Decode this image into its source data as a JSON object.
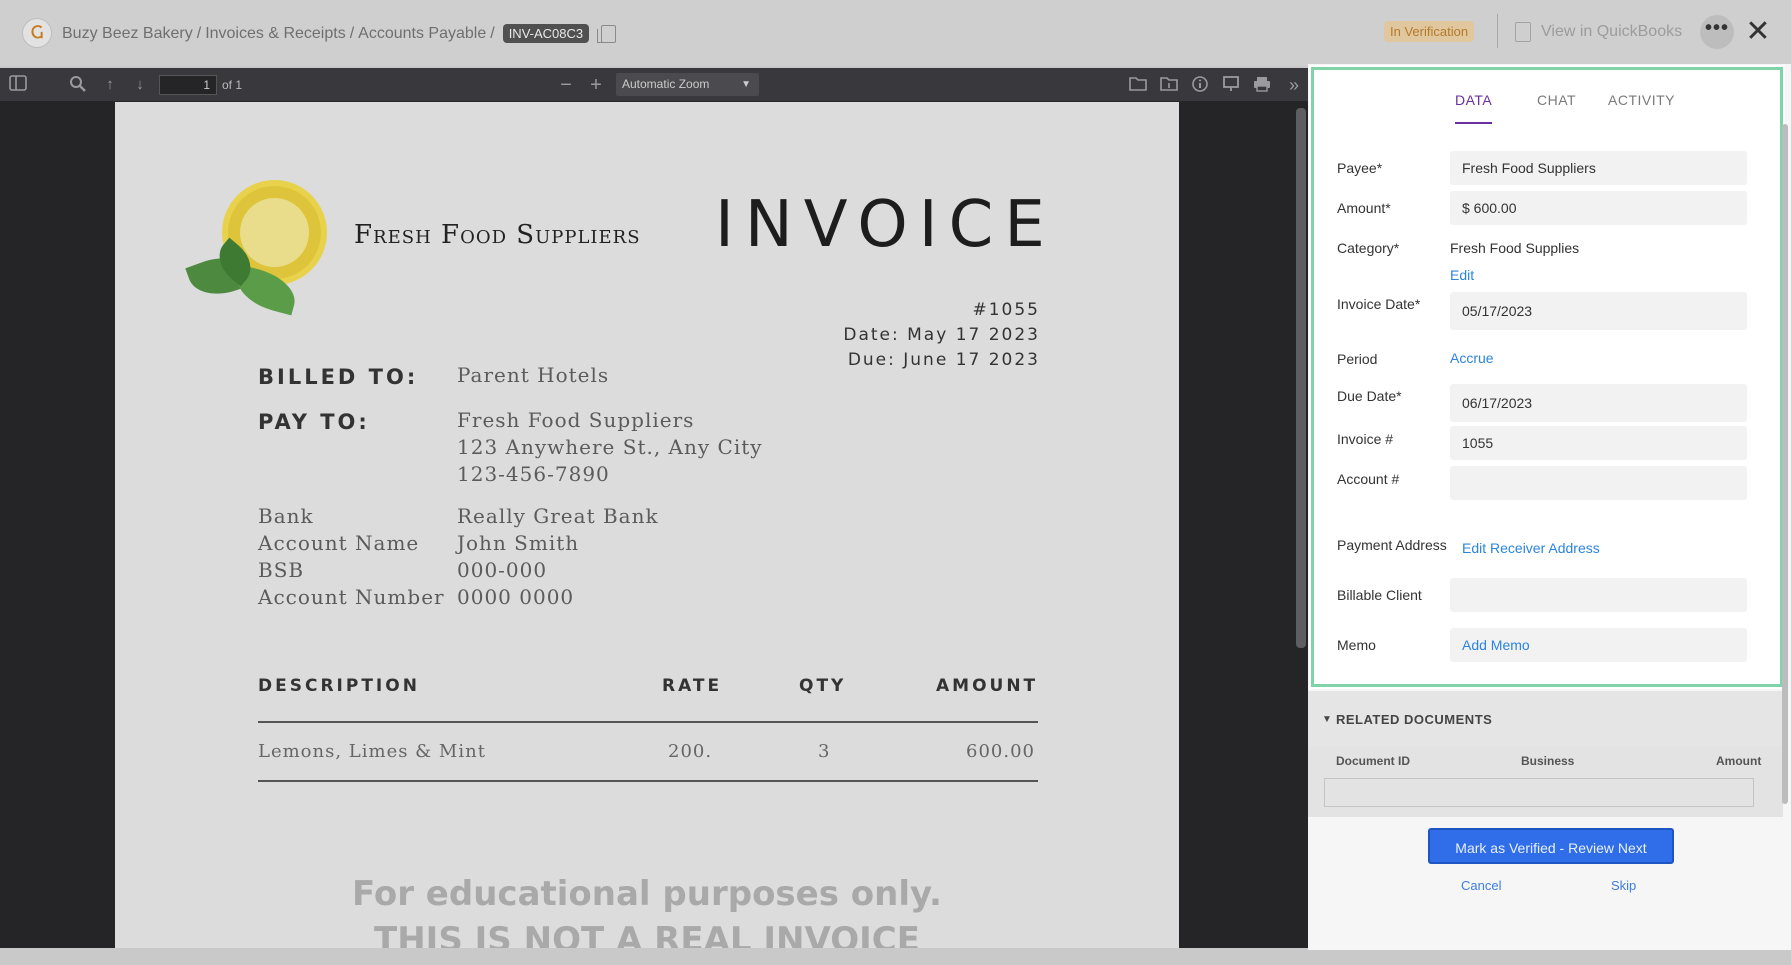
{
  "header": {
    "breadcrumb": [
      "Buzy Beez Bakery",
      "Invoices & Receipts",
      "Accounts Payable"
    ],
    "separator": "/",
    "invoice_id": "INV-AC08C3",
    "status": "In Verification",
    "quickbooks_label": "View in QuickBooks",
    "more_label": "•••",
    "close_label": "✕",
    "logo_glyph": "Ⴚ"
  },
  "pdf_toolbar": {
    "page_number": "1",
    "page_of": "of 1",
    "zoom": "Automatic Zoom",
    "icons": [
      "sidebar-toggle-icon",
      "search-icon",
      "arrow-up-icon",
      "arrow-down-icon",
      "zoom-out-icon",
      "zoom-in-icon",
      "open-file-icon",
      "save-icon",
      "info-icon",
      "present-icon",
      "print-icon",
      "double-chevron-icon"
    ]
  },
  "pdf": {
    "company": "Fresh Food Suppliers",
    "title": "INVOICE",
    "number": "#1055",
    "date": "Date: May 17 2023",
    "due": "Due: June 17 2023",
    "billed_to_label": "BILLED TO:",
    "billed_to": "Parent Hotels",
    "pay_to_label": "PAY TO:",
    "pay_to_name": "Fresh Food Suppliers",
    "pay_to_address": "123 Anywhere St., Any City",
    "pay_to_phone": "123-456-7890",
    "bank_labels": [
      "Bank",
      "Account Name",
      "BSB",
      "Account Number"
    ],
    "bank_values": [
      "Really Great Bank",
      "John Smith",
      "000-000",
      "0000 0000"
    ],
    "columns": [
      "DESCRIPTION",
      "RATE",
      "QTY",
      "AMOUNT"
    ],
    "rows": [
      {
        "description": "Lemons, Limes & Mint",
        "rate": "200.",
        "qty": "3",
        "amount": "600.00"
      }
    ],
    "watermark_1": "For educational purposes only.",
    "watermark_2": "THIS IS NOT A REAL INVOICE"
  },
  "panel": {
    "tabs": [
      "DATA",
      "CHAT",
      "ACTIVITY"
    ],
    "active_tab": "DATA",
    "fields": {
      "payee_label": "Payee*",
      "payee": "Fresh Food Suppliers",
      "amount_label": "Amount*",
      "amount": "$ 600.00",
      "category_label": "Category*",
      "category": "Fresh Food Supplies",
      "category_edit": "Edit",
      "invoice_date_label": "Invoice Date*",
      "invoice_date": "05/17/2023",
      "period_label": "Period",
      "period": "Accrue",
      "due_date_label": "Due Date*",
      "due_date": "06/17/2023",
      "invoice_no_label": "Invoice #",
      "invoice_no": "1055",
      "account_no_label": "Account #",
      "account_no": "",
      "payment_address_label": "Payment Address",
      "payment_address_link": "Edit Receiver Address",
      "billable_client_label": "Billable Client",
      "billable_client": "",
      "memo_label": "Memo",
      "memo_link": "Add Memo"
    },
    "related": {
      "title": "RELATED DOCUMENTS",
      "columns": [
        "Document ID",
        "Business",
        "Amount"
      ]
    },
    "actions": {
      "verify": "Mark as Verified - Review Next",
      "cancel": "Cancel",
      "skip": "Skip"
    }
  },
  "colors": {
    "accent": "#6a2fa0",
    "link": "#2c84df",
    "primary_button": "#2f6ee8",
    "highlight_border": "#7ed3a8",
    "status_bg": "#e0c79e"
  }
}
